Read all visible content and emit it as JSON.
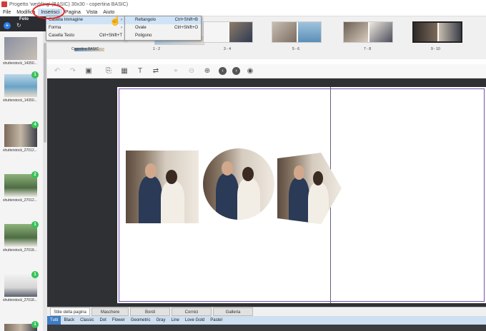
{
  "window": {
    "title": "Progetto 'wedding' (BASIC) 30x30 - copertina BASIC)"
  },
  "menubar": {
    "items": [
      "File",
      "Modifica",
      "Inserisci",
      "Pagina",
      "Vista",
      "Aiuto"
    ],
    "active": "Inserisci"
  },
  "sidebar": {
    "header": "Foto",
    "add_icon": "plus-icon",
    "refresh_icon": "refresh-icon",
    "photos": [
      {
        "name": "shutterstock_14350...",
        "badge": ""
      },
      {
        "name": "shutterstock_14350...",
        "badge": "1"
      },
      {
        "name": "shutterstock_27012...",
        "badge": "4"
      },
      {
        "name": "shutterstock_27012...",
        "badge": "2"
      },
      {
        "name": "shutterstock_27018...",
        "badge": "1"
      },
      {
        "name": "shutterstock_27018...",
        "badge": "1"
      },
      {
        "name": "",
        "badge": "1"
      }
    ]
  },
  "pagestrip": {
    "labels": [
      "Copertina BASIC",
      "1 - 2",
      "3 - 4",
      "5 - 6",
      "7 - 8",
      "9 - 10"
    ]
  },
  "insert_menu": {
    "items": [
      {
        "label": "Casella Immagine",
        "shortcut": "",
        "arrow": "›"
      },
      {
        "label": "Forma",
        "shortcut": "",
        "arrow": "›"
      },
      {
        "label": "Casella Testo",
        "shortcut": "Ctrl+Shift+T",
        "arrow": ""
      }
    ]
  },
  "image_submenu": {
    "items": [
      {
        "label": "Rettangolo",
        "shortcut": "Ctrl+Shift+B"
      },
      {
        "label": "Ovale",
        "shortcut": "Ctrl+Shift+O"
      },
      {
        "label": "Poligono",
        "shortcut": ""
      }
    ]
  },
  "toolbar": {
    "icons": [
      "undo-icon",
      "redo-icon",
      "save-icon",
      "add-page-icon",
      "add-image-icon",
      "add-text-icon",
      "replace-icon",
      "fit-icon",
      "zoom-out-icon",
      "zoom-in-icon",
      "prev-icon",
      "next-icon",
      "preview-icon"
    ],
    "glyphs": {
      "undo": "↶",
      "redo": "↷",
      "save": "▣",
      "page": "⎘",
      "image": "▦",
      "text": "T",
      "replace": "⇄",
      "fit": "⌖",
      "zoom_out": "⊖",
      "zoom_in": "⊕",
      "prev": "‹",
      "next": "›",
      "preview": "◉"
    }
  },
  "bottom_panel": {
    "tabs": [
      "Stile della pagina",
      "Maschere",
      "Bordi",
      "Cornici",
      "Galleria"
    ],
    "filters": [
      "Tutti",
      "Black",
      "Classic",
      "Dot",
      "Flower",
      "Geometric",
      "Gray",
      "Line",
      "Love Gold",
      "Pastel"
    ],
    "active_filter": "Tutti"
  },
  "colors": {
    "accent": "#3d7cc4",
    "badge": "#36c257",
    "annotation": "#e02424",
    "page_border": "#7b4fb3"
  }
}
